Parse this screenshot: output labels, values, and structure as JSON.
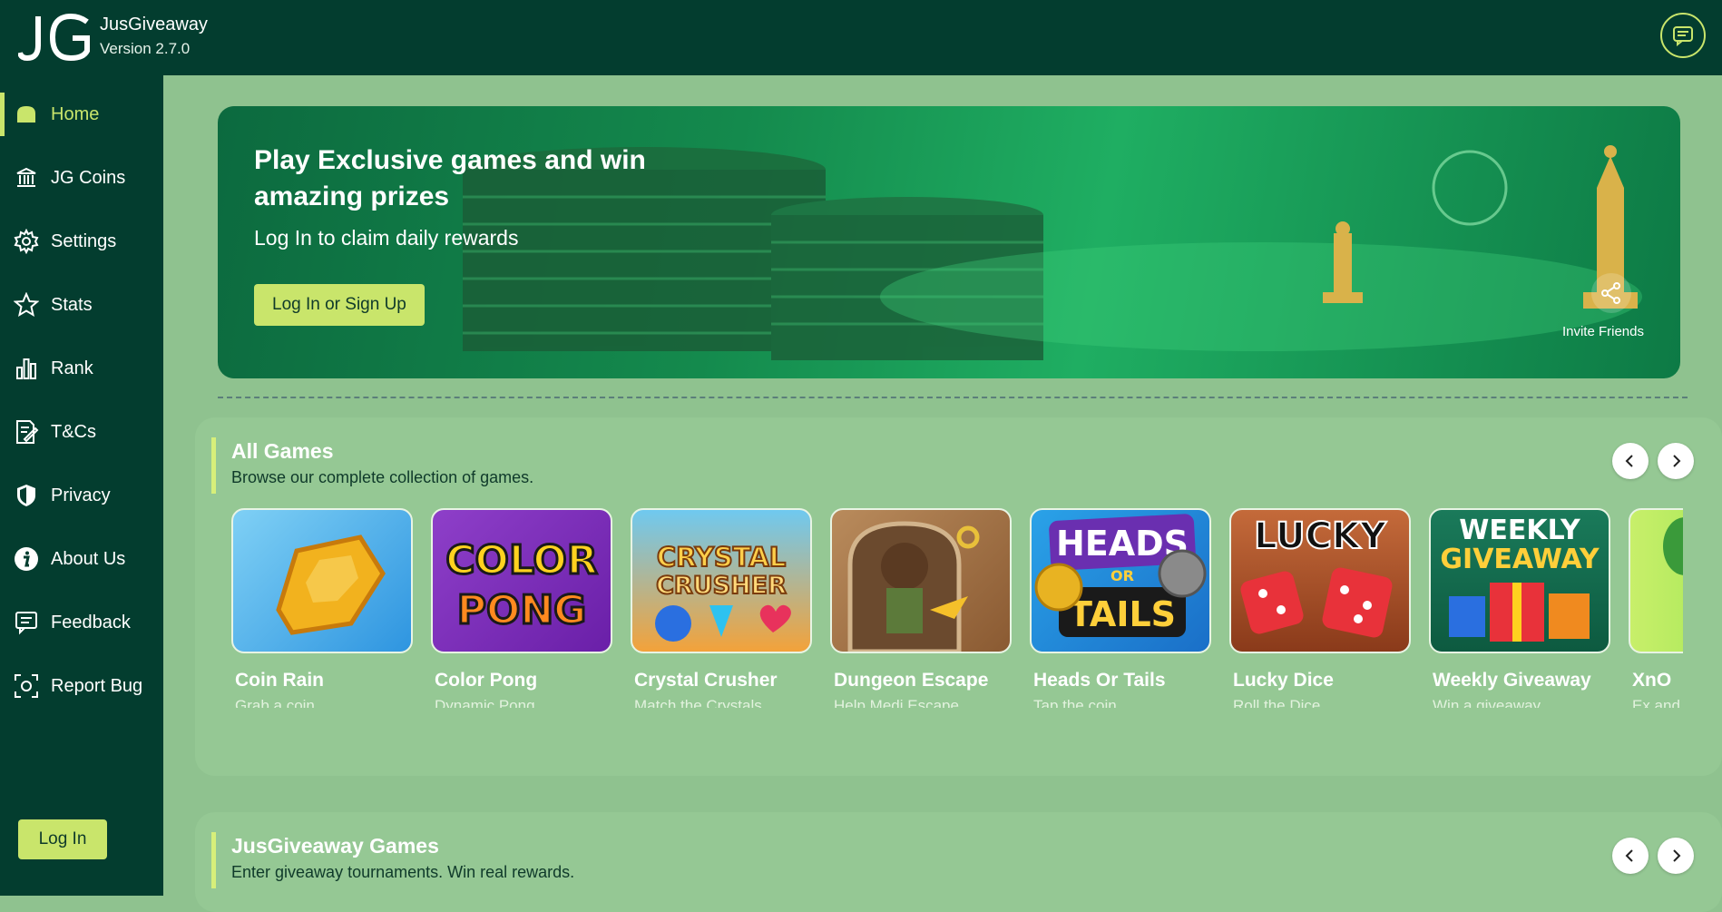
{
  "app": {
    "name": "JusGiveaway",
    "version": "Version 2.7.0",
    "logo_text": "JG"
  },
  "icons": {
    "chat": "chat-bubble-icon",
    "share": "share-icon"
  },
  "colors": {
    "sidebar": "#033d2f",
    "accent": "#c9e56b",
    "background": "#8fc28f"
  },
  "sidebar": {
    "items": [
      {
        "label": "Home",
        "icon": "home-icon",
        "active": true
      },
      {
        "label": "JG Coins",
        "icon": "bank-icon"
      },
      {
        "label": "Settings",
        "icon": "gear-icon"
      },
      {
        "label": "Stats",
        "icon": "star-icon"
      },
      {
        "label": "Rank",
        "icon": "bar-chart-icon"
      },
      {
        "label": "T&Cs",
        "icon": "document-edit-icon"
      },
      {
        "label": "Privacy",
        "icon": "shield-icon"
      },
      {
        "label": "About Us",
        "icon": "info-icon"
      },
      {
        "label": "Feedback",
        "icon": "feedback-icon"
      },
      {
        "label": "Report Bug",
        "icon": "bug-scan-icon"
      }
    ],
    "login_label": "Log In"
  },
  "hero": {
    "title": "Play Exclusive games and win amazing prizes",
    "subtitle": "Log In to claim daily rewards",
    "button_label": "Log In or Sign Up",
    "invite_label": "Invite Friends"
  },
  "all_games": {
    "title": "All Games",
    "subtitle": "Browse our complete collection of games.",
    "games": [
      {
        "title": "Coin Rain",
        "desc": "Grab a coin",
        "art": "COIN"
      },
      {
        "title": "Color Pong",
        "desc": "Dynamic Pong",
        "art": "COLOR PONG"
      },
      {
        "title": "Crystal Crusher",
        "desc": "Match the Crystals",
        "art": "CRYSTAL CRUSHER"
      },
      {
        "title": "Dungeon Escape",
        "desc": "Help Medi Escape",
        "art": ""
      },
      {
        "title": "Heads Or Tails",
        "desc": "Tap the coin",
        "art": "HEADS OR TAILS"
      },
      {
        "title": "Lucky Dice",
        "desc": "Roll the Dice",
        "art": "LUCKY"
      },
      {
        "title": "Weekly Giveaway",
        "desc": "Win a giveaway",
        "art": "WEEKLY GIVEAWAY"
      },
      {
        "title": "XnO",
        "desc": "Ex and O",
        "art": ""
      }
    ]
  },
  "jg_games": {
    "title": "JusGiveaway Games",
    "subtitle": "Enter giveaway tournaments. Win real rewards."
  }
}
